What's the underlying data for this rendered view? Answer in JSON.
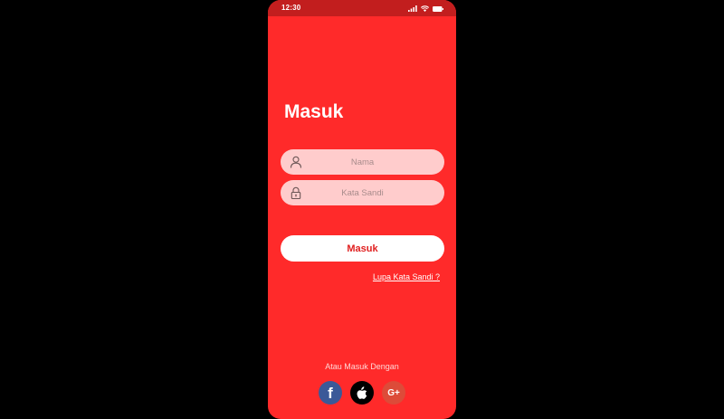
{
  "status_bar": {
    "time": "12:30",
    "icons": [
      "signal-icon",
      "wifi-icon",
      "battery-icon"
    ]
  },
  "login": {
    "title": "Masuk",
    "name_placeholder": "Nama",
    "password_placeholder": "Kata Sandi",
    "submit_label": "Masuk",
    "forgot_label": "Lupa Kata Sandi ?"
  },
  "alt_login": {
    "label": "Atau Masuk Dengan",
    "providers": [
      {
        "name": "facebook",
        "glyph": "f",
        "color": "#3B5998"
      },
      {
        "name": "apple",
        "glyph": "",
        "color": "#000000"
      },
      {
        "name": "google",
        "glyph": "G+",
        "color": "#DD4B39"
      }
    ]
  },
  "colors": {
    "primary": "#FF2A2A",
    "status_bar": "#C21E1E",
    "field_bg": "#FFCCCC",
    "button_text": "#E01F1F"
  }
}
